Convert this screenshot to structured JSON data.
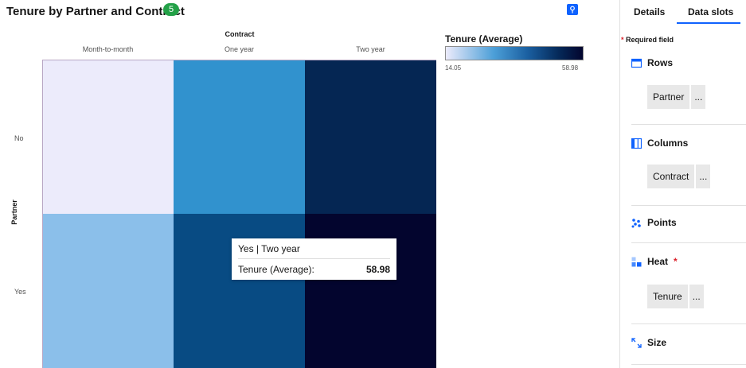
{
  "header": {
    "title": "Tenure by Partner and Contract",
    "badge": "5"
  },
  "chart_data": {
    "type": "heatmap",
    "title": "Tenure by Partner and Contract",
    "x_title": "Contract",
    "y_title": "Partner",
    "columns": [
      "Month-to-month",
      "One year",
      "Two year"
    ],
    "rows": [
      "No",
      "Yes"
    ],
    "cells": [
      {
        "row": "No",
        "col": "Month-to-month",
        "value": 14.05,
        "color": "#ecebfb"
      },
      {
        "row": "No",
        "col": "One year",
        "value": 33.5,
        "color": "#3192ce"
      },
      {
        "row": "No",
        "col": "Two year",
        "value": 52.5,
        "color": "#052653"
      },
      {
        "row": "Yes",
        "col": "Month-to-month",
        "value": 24.0,
        "color": "#8bbfea"
      },
      {
        "row": "Yes",
        "col": "One year",
        "value": 45.0,
        "color": "#084b83"
      },
      {
        "row": "Yes",
        "col": "Two year",
        "value": 58.98,
        "color": "#03052e"
      }
    ],
    "legend": {
      "title": "Tenure (Average)",
      "min_label": "14.05",
      "max_label": "58.98"
    }
  },
  "tooltip": {
    "header": "Yes | Two year",
    "label": "Tenure (Average):",
    "value": "58.98"
  },
  "panel": {
    "tabs": [
      "Details",
      "Data slots"
    ],
    "active_tab": "Data slots",
    "required_note": "Required field",
    "slots": [
      {
        "name": "Rows",
        "chip": "Partner",
        "more": "..."
      },
      {
        "name": "Columns",
        "chip": "Contract",
        "more": "..."
      },
      {
        "name": "Points"
      },
      {
        "name": "Heat",
        "required": true,
        "chip": "Tenure",
        "more": "..."
      },
      {
        "name": "Size"
      }
    ]
  },
  "colors": {
    "accent": "#0f62fe",
    "badge": "#24a148",
    "required": "#da1e28"
  },
  "icons": [
    "pin-icon",
    "rows-icon",
    "columns-icon",
    "points-icon",
    "heat-icon",
    "size-icon"
  ]
}
